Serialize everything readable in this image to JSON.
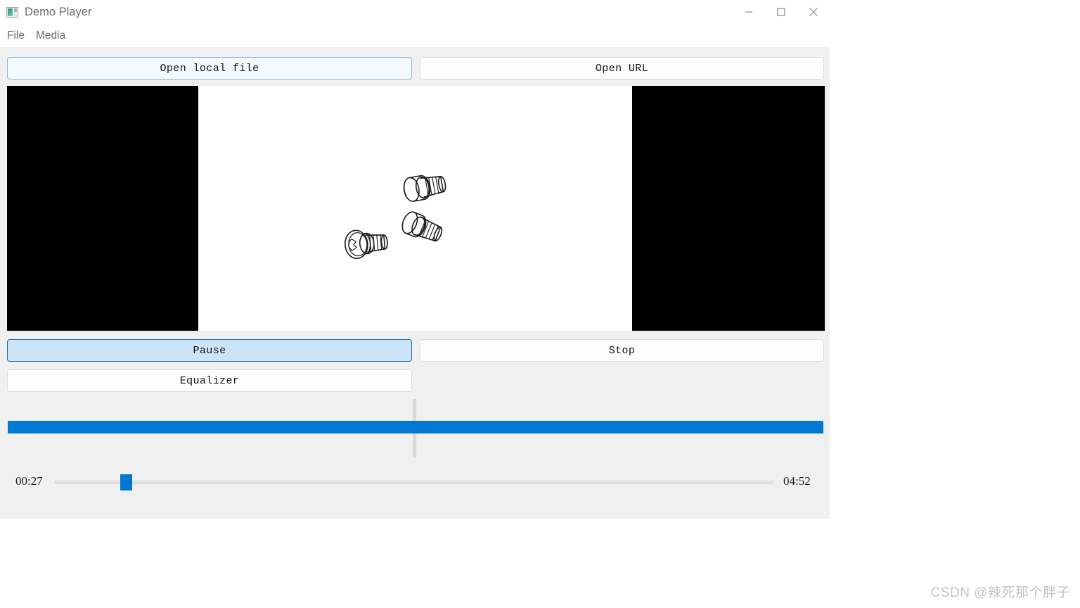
{
  "window": {
    "title": "Demo Player",
    "icon": "image-thumbnail-icon",
    "controls": {
      "minimize": "minimize-icon",
      "maximize": "maximize-icon",
      "close": "close-icon"
    }
  },
  "menu": {
    "items": [
      {
        "label": "File"
      },
      {
        "label": "Media"
      }
    ]
  },
  "toolbar": {
    "open_local_label": "Open local file",
    "open_url_label": "Open URL"
  },
  "transport": {
    "pause_label": "Pause",
    "stop_label": "Stop",
    "equalizer_label": "Equalizer"
  },
  "video": {
    "content_description": "three line-art machine screws on white background",
    "pillarbox_color": "#000000",
    "frame_color": "#ffffff"
  },
  "volume": {
    "orientation": "vertical-groove",
    "handle_color": "#0078d4",
    "groove_color": "#dcdcdc"
  },
  "seek": {
    "current_time": "00:27",
    "total_time": "04:52",
    "handle_color": "#0078d4",
    "track_color": "#e4e4e4",
    "progress_percent": 9
  },
  "colors": {
    "accent": "#0078d4",
    "button_active_fill": "#cce4f7",
    "button_active_border": "#1f6ba8",
    "button_hover_fill": "#f4f9fe",
    "button_hover_border": "#8ab6dd",
    "client_background": "#f0f0f0",
    "titlebar_background": "#ffffff",
    "title_text": "#6d6d6d"
  },
  "watermark": {
    "text": "CSDN @辣死那个胖子"
  }
}
